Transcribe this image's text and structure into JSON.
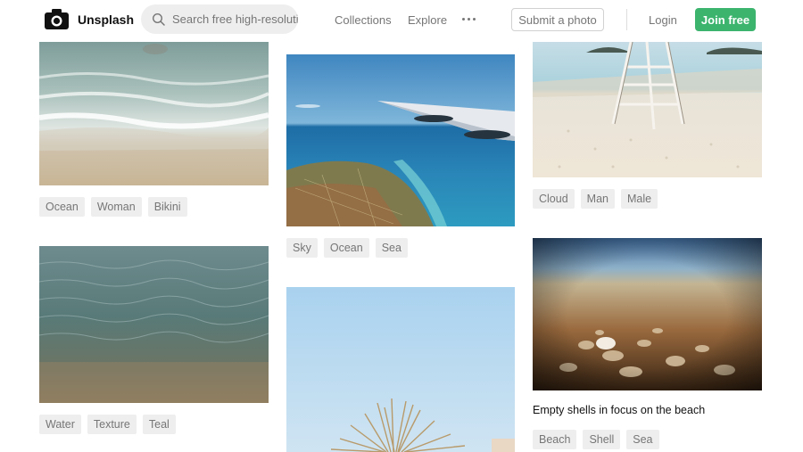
{
  "header": {
    "brand": "Unsplash",
    "search_placeholder": "Search free high-resolution photos",
    "nav": {
      "collections": "Collections",
      "explore": "Explore"
    },
    "submit_label": "Submit a photo",
    "login_label": "Login",
    "join_label": "Join free"
  },
  "photos": {
    "shoreline": {
      "tags": [
        "Ocean",
        "Woman",
        "Bikini"
      ]
    },
    "wing": {
      "tags": [
        "Sky",
        "Ocean",
        "Sea"
      ]
    },
    "lifeguard": {
      "tags": [
        "Cloud",
        "Man",
        "Male"
      ]
    },
    "water": {
      "tags": [
        "Water",
        "Texture",
        "Teal"
      ]
    },
    "shells": {
      "caption": "Empty shells in focus on the beach",
      "tags": [
        "Beach",
        "Shell",
        "Sea"
      ]
    }
  }
}
